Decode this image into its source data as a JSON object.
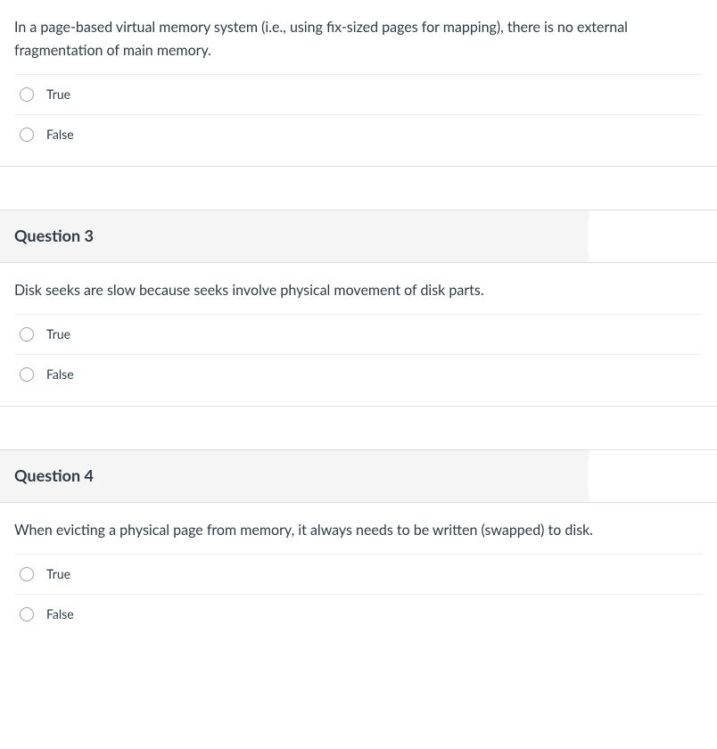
{
  "questions": [
    {
      "header": "",
      "text": "In a page-based virtual memory system (i.e., using fix-sized pages for mapping), there is no external fragmentation of main memory.",
      "options": {
        "true": "True",
        "false": "False"
      }
    },
    {
      "header": "Question 3",
      "text": "Disk seeks are slow because seeks involve physical movement of disk parts.",
      "options": {
        "true": "True",
        "false": "False"
      }
    },
    {
      "header": "Question 4",
      "text": "When evicting a physical page from memory, it always needs to be written (swapped) to disk.",
      "options": {
        "true": "True",
        "false": "False"
      }
    }
  ]
}
